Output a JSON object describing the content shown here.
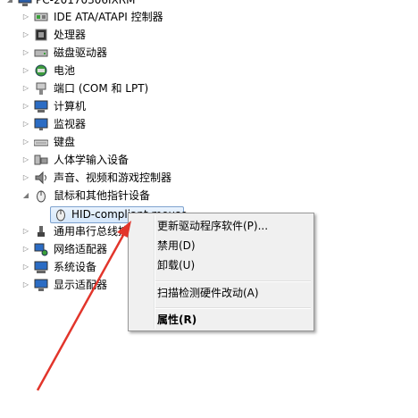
{
  "tree": {
    "root_label": "PC-20170306IXRM",
    "items": [
      {
        "label": "IDE ATA/ATAPI 控制器",
        "icon": "ide-controller-icon"
      },
      {
        "label": "处理器",
        "icon": "processor-icon"
      },
      {
        "label": "磁盘驱动器",
        "icon": "disk-drive-icon"
      },
      {
        "label": "电池",
        "icon": "battery-icon"
      },
      {
        "label": "端口 (COM 和 LPT)",
        "icon": "port-icon"
      },
      {
        "label": "计算机",
        "icon": "computer-icon"
      },
      {
        "label": "监视器",
        "icon": "monitor-icon"
      },
      {
        "label": "键盘",
        "icon": "keyboard-icon"
      },
      {
        "label": "人体学输入设备",
        "icon": "hid-icon"
      },
      {
        "label": "声音、视频和游戏控制器",
        "icon": "sound-icon"
      },
      {
        "label": "鼠标和其他指针设备",
        "icon": "mouse-icon",
        "expanded": true
      },
      {
        "label": "HID-compliant mouse",
        "icon": "mouse-icon",
        "child": true,
        "selected": true
      },
      {
        "label": "通用串行总线控",
        "icon": "usb-icon"
      },
      {
        "label": "网络适配器",
        "icon": "network-adapter-icon"
      },
      {
        "label": "系统设备",
        "icon": "system-device-icon"
      },
      {
        "label": "显示适配器",
        "icon": "display-adapter-icon"
      }
    ]
  },
  "context_menu": {
    "update_driver": "更新驱动程序软件(P)...",
    "disable": "禁用(D)",
    "uninstall": "卸载(U)",
    "scan": "扫描检测硬件改动(A)",
    "properties": "属性(R)"
  },
  "colors": {
    "selection_border": "#7da2ce",
    "menu_bg": "#f0f0f0",
    "arrow": "#e2352b"
  }
}
